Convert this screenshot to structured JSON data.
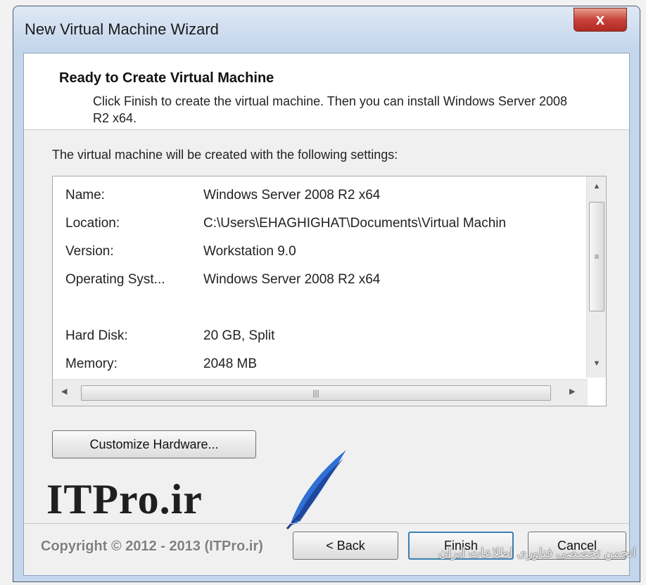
{
  "window": {
    "title": "New Virtual Machine Wizard",
    "close_symbol": "x"
  },
  "header": {
    "title": "Ready to Create Virtual Machine",
    "description": "Click Finish to create the virtual machine. Then you can install Windows Server 2008 R2 x64."
  },
  "intro_text": "The virtual machine will be created with the following settings:",
  "settings": [
    {
      "name": "Name:",
      "value": "Windows Server 2008 R2 x64"
    },
    {
      "name": "Location:",
      "value": "C:\\Users\\EHAGHIGHAT\\Documents\\Virtual Machin"
    },
    {
      "name": "Version:",
      "value": "Workstation 9.0"
    },
    {
      "name": "Operating Syst...",
      "value": "Windows Server 2008 R2 x64"
    },
    {
      "name": "",
      "value": ""
    },
    {
      "name": "Hard Disk:",
      "value": "20 GB, Split"
    },
    {
      "name": "Memory:",
      "value": "2048 MB"
    }
  ],
  "buttons": {
    "customize": "Customize Hardware...",
    "back": "< Back",
    "finish": "Finish",
    "cancel": "Cancel"
  },
  "watermark": {
    "logo": "ITPro.ir",
    "copyright": "Copyright © 2012 - 2013 (ITPro.ir)",
    "persian_text": "انجمن تخصصی فناوری اطلاعات ایران"
  },
  "icons": {
    "close": "close-icon",
    "scroll_up": "chevron-up-icon",
    "scroll_down": "chevron-down-icon",
    "scroll_left": "chevron-left-icon",
    "scroll_right": "chevron-right-icon",
    "feather": "feather-icon"
  },
  "colors": {
    "close_button": "#c8423a",
    "finish_border": "#3c7fb1",
    "logo_blue": "#2f6fd6"
  }
}
